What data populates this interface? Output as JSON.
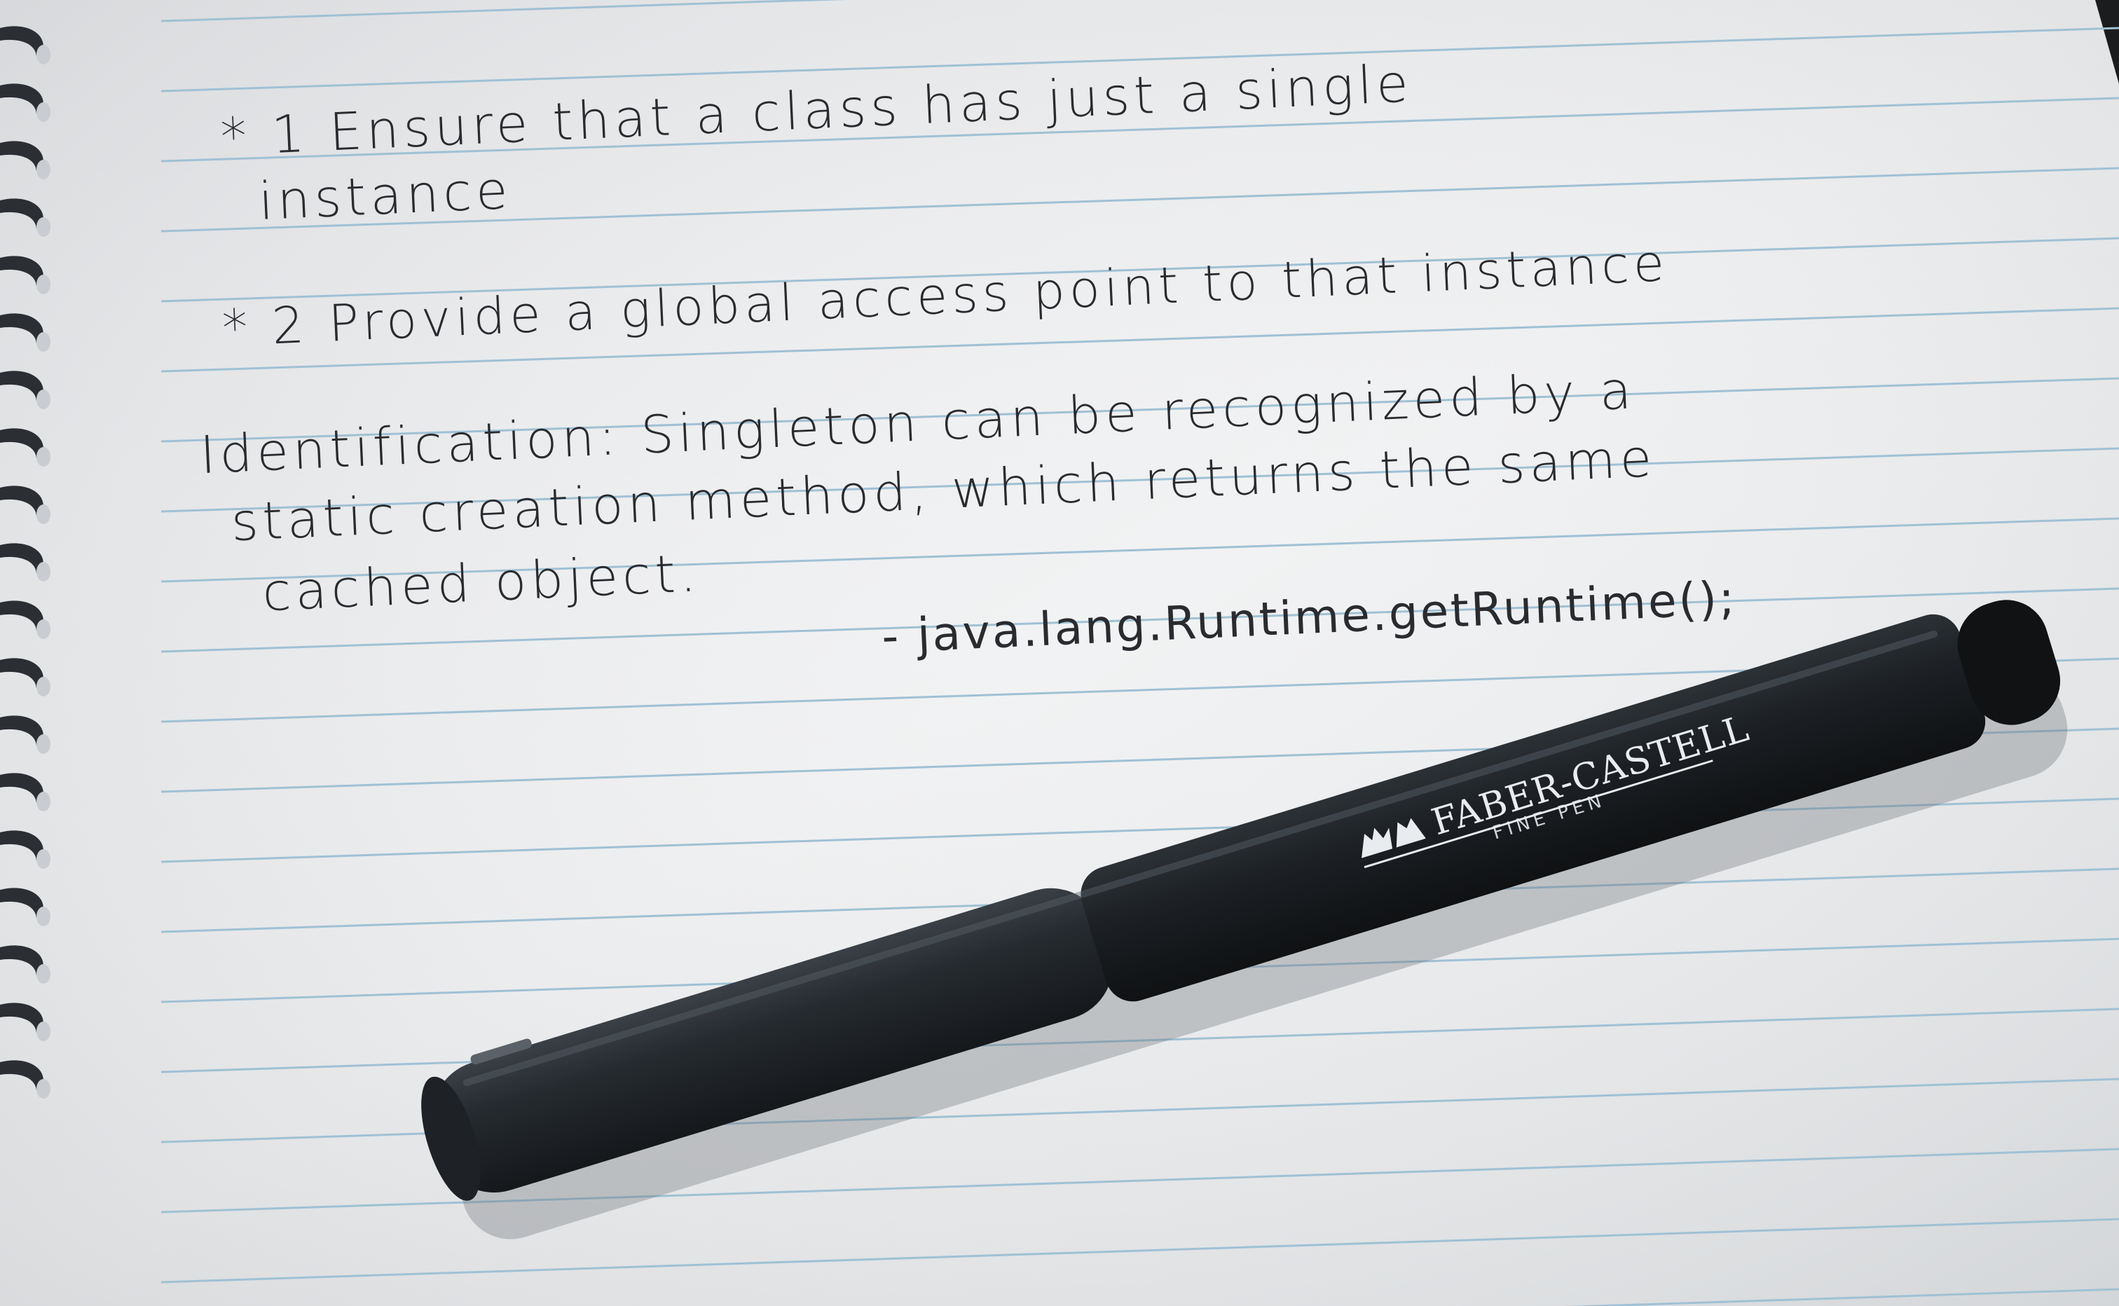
{
  "notes": {
    "line1": "* 1 Ensure that a class has just a single",
    "line2": "instance",
    "line3": "* 2 Provide a global access point to that instance",
    "line4": "Identification: Singleton can be recognized by a",
    "line5": "static creation method, which returns the same",
    "line6": "cached object.",
    "line7": "- java.lang.Runtime.getRuntime();"
  },
  "pen": {
    "brand": "FABER-CASTELL",
    "model": "FINE PEN",
    "color": "#22272b"
  },
  "colors": {
    "paper": "#eff0f1",
    "rule_line": "#9fc1d4",
    "ink": "#2a2b2f",
    "background": "#1b1c1e"
  }
}
